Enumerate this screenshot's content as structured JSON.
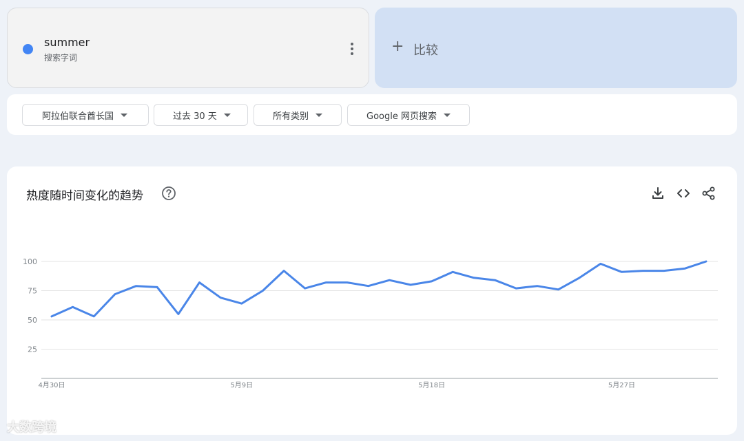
{
  "term": {
    "name": "summer",
    "subtitle": "搜索字词",
    "color": "#4285f4"
  },
  "compare": {
    "plus": "+",
    "label": "比较"
  },
  "filters": {
    "region": "阿拉伯联合酋长国",
    "time": "过去 30 天",
    "category": "所有类别",
    "source": "Google 网页搜索"
  },
  "chart_section": {
    "title": "热度随时间变化的趋势",
    "help_icon": "help-circle-icon",
    "tools": [
      "download-icon",
      "embed-code-icon",
      "share-icon"
    ]
  },
  "chart_data": {
    "type": "line",
    "xlabel": "",
    "ylabel": "",
    "ylim": [
      0,
      100
    ],
    "yticks": [
      "100",
      "75",
      "50",
      "25"
    ],
    "yticks_values": [
      100,
      75,
      50,
      25
    ],
    "xtick_labels": [
      "4月30日",
      "5月9日",
      "5月18日",
      "5月27日"
    ],
    "xtick_index": [
      0,
      9,
      18,
      27
    ],
    "grid": true,
    "line_color": "#4a86e8",
    "series": [
      {
        "name": "summer",
        "values": [
          53,
          61,
          53,
          72,
          79,
          78,
          55,
          82,
          69,
          64,
          75,
          92,
          77,
          82,
          82,
          79,
          84,
          80,
          83,
          91,
          86,
          84,
          77,
          79,
          76,
          86,
          98,
          91,
          92,
          92,
          94,
          100
        ]
      }
    ]
  },
  "watermark": "大数跨境"
}
